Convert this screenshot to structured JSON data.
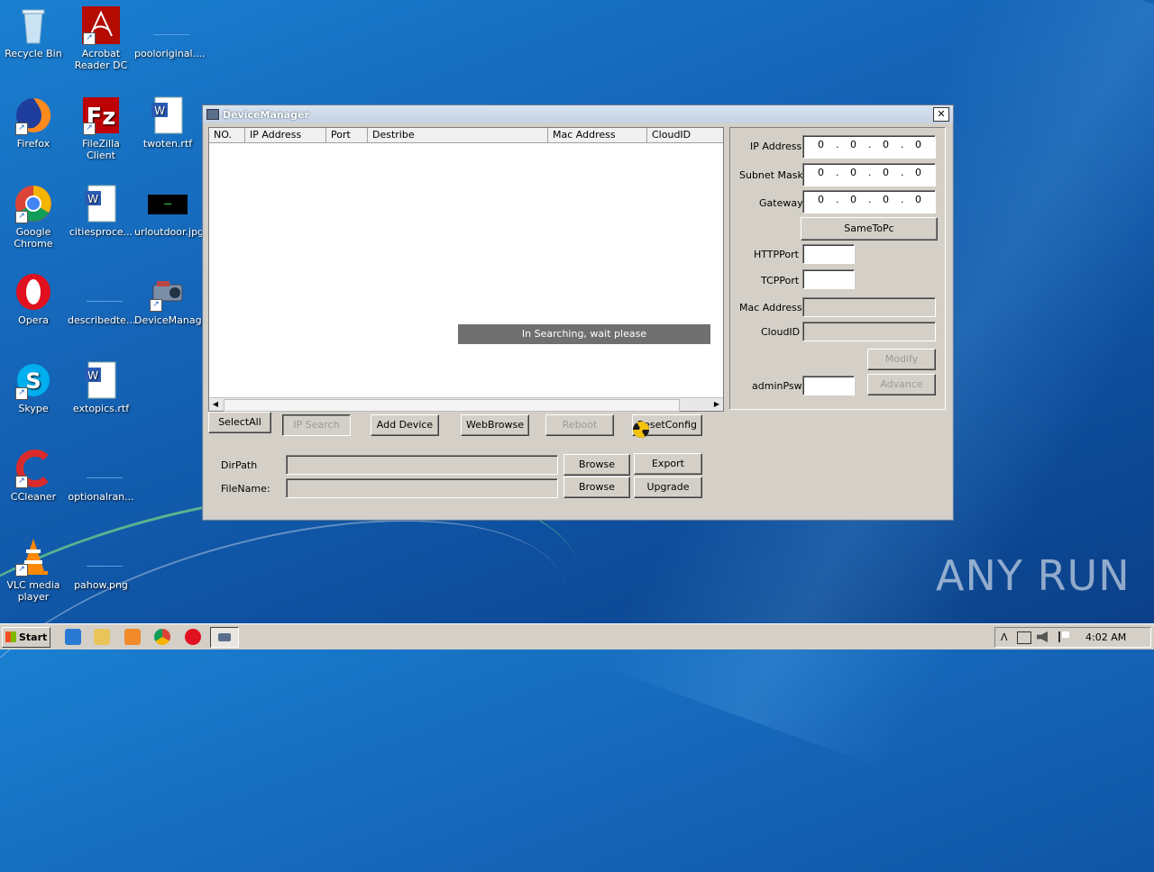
{
  "desktop": {
    "icons": [
      {
        "label": "Recycle Bin"
      },
      {
        "label": "Acrobat Reader DC"
      },
      {
        "label": "pooloriginal...."
      },
      {
        "label": "Firefox"
      },
      {
        "label": "FileZilla Client"
      },
      {
        "label": "twoten.rtf"
      },
      {
        "label": "Google Chrome"
      },
      {
        "label": "citiesproce..."
      },
      {
        "label": "urloutdoor.jpg"
      },
      {
        "label": "Opera"
      },
      {
        "label": "describedte..."
      },
      {
        "label": "DeviceManage"
      },
      {
        "label": "Skype"
      },
      {
        "label": "extopics.rtf"
      },
      {
        "label": "CCleaner"
      },
      {
        "label": "optionalran..."
      },
      {
        "label": "VLC media player"
      },
      {
        "label": "pahow.png"
      }
    ]
  },
  "window": {
    "title": "DeviceManager",
    "close_glyph": "✕",
    "list": {
      "columns": [
        "NO.",
        "IP Address",
        "Port",
        "Destribe",
        "Mac Address",
        "CloudID"
      ],
      "status_overlay": "In Searching, wait please",
      "scroll_left": "◀",
      "scroll_right": "▶"
    },
    "buttons": {
      "select_all": "SelectAll",
      "ip_search": "IP Search",
      "add_device": "Add Device",
      "web_browse": "WebBrowse",
      "reboot": "Reboot",
      "reset_config": "ResetConfig",
      "browse1": "Browse",
      "browse2": "Browse",
      "export": "Export",
      "upgrade": "Upgrade"
    },
    "files": {
      "dirpath_label": "DirPath",
      "filename_label": "FileName:",
      "dirpath_value": "",
      "filename_value": ""
    },
    "network": {
      "ip_label": "IP Address",
      "ip_octets": [
        "0",
        "0",
        "0",
        "0"
      ],
      "subnet_label": "Subnet Mask",
      "subnet_octets": [
        "0",
        "0",
        "0",
        "0"
      ],
      "gateway_label": "Gateway",
      "gateway_octets": [
        "0",
        "0",
        "0",
        "0"
      ],
      "same_to_pc": "SameToPc",
      "http_port_label": "HTTPPort",
      "tcp_port_label": "TCPPort",
      "mac_label": "Mac Address",
      "cloudid_label": "CloudID",
      "modify": "Modify",
      "advance": "Advance",
      "admin_psw_label": "adminPsw",
      "http_port_value": "",
      "tcp_port_value": "",
      "admin_psw_value": ""
    }
  },
  "taskbar": {
    "start_label": "Start",
    "clock": "4:02 AM",
    "tray_chevron": "ᐱ"
  },
  "watermark": "ANY RUN"
}
